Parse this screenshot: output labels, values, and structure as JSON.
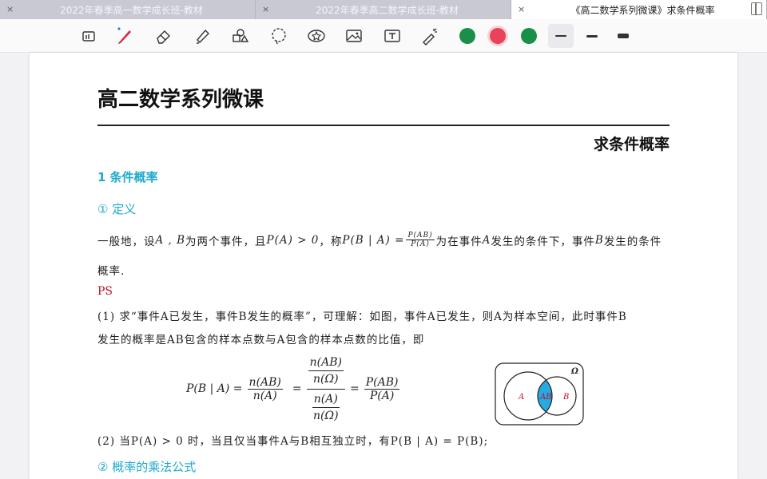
{
  "tabs": [
    {
      "title": "2022年春季高一数学成长班-教材",
      "close": "×"
    },
    {
      "title": "2022年春季高二数学成长班-教材",
      "close": "×"
    },
    {
      "title": "《高二数学系列微课》求条件概率",
      "close": "×"
    }
  ],
  "toolbar": {
    "tools": [
      "screen-icon",
      "pen-icon",
      "eraser-icon",
      "highlighter-icon",
      "shapes-icon",
      "lasso-icon",
      "sticker-icon",
      "image-icon",
      "text-icon",
      "laser-pointer-icon"
    ],
    "colors": [
      "#1a8f4a",
      "#e8435a",
      "#1a8f4a"
    ],
    "strokes": [
      "thin",
      "medium",
      "thick"
    ]
  },
  "doc": {
    "title": "高二数学系列微课",
    "subtitle": "求条件概率",
    "section1": "1 条件概率",
    "sub1": "① 定义",
    "def_line1_a": "一般地，设",
    "def_line1_b": "为两个事件，且",
    "def_line1_c": "，称",
    "def_line1_d": "为在事件",
    "def_line1_e": "发生的条件下，事件",
    "def_line1_f": "发生的条件",
    "def_line2": "概率.",
    "ps": "PS",
    "p1_line1": "(1) 求“事件A已发生，事件B发生的概率”，可理解：如图，事件A已发生，则A为样本空间，此时事件B",
    "p1_line2": "发生的概率是AB包含的样本点数与A包含的样本点数的比值，即",
    "p2": "(2)  当P(A) > 0 时，当且仅当事件A与B相互独立时，有P(B | A) = P(B);",
    "sub2": "② 概率的乘法公式",
    "math": {
      "AB": "A , B",
      "PA_gt0": "P(A) > 0",
      "PBgA": "P(B | A) =",
      "frac_num": "P(AB)",
      "frac_den": "P(A)",
      "A": "A",
      "B": "B",
      "f_lhs": "P(B | A) =",
      "f_n1": "n(AB)",
      "f_d1": "n(A)",
      "f_nn": "n(AB)",
      "f_nd": "n(Ω)",
      "f_dn": "n(A)",
      "f_dd": "n(Ω)",
      "f_p_num": "P(AB)",
      "f_p_den": "P(A)",
      "eq": "="
    },
    "venn": {
      "omega": "Ω",
      "a": "A",
      "ab": "AB",
      "b": "B",
      "highlight": "#27a9e1"
    }
  }
}
